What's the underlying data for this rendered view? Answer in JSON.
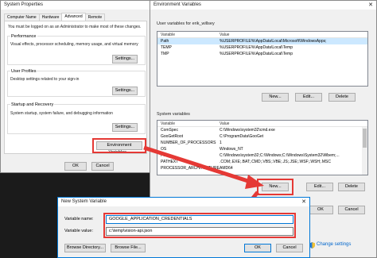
{
  "system_properties": {
    "title": "System Properties",
    "tabs": [
      "Computer Name",
      "Hardware",
      "Advanced",
      "Remote"
    ],
    "admin_note": "You must be logged on as an Administrator to make most of these changes.",
    "performance": {
      "title": "Performance",
      "desc": "Visual effects, processor scheduling, memory usage, and virtual memory",
      "button": "Settings..."
    },
    "user_profiles": {
      "title": "User Profiles",
      "desc": "Desktop settings related to your sign-in",
      "button": "Settings..."
    },
    "startup": {
      "title": "Startup and Recovery",
      "desc": "System startup, system failure, and debugging information",
      "button": "Settings..."
    },
    "env_button": "Environment Variables...",
    "ok": "OK",
    "cancel": "Cancel"
  },
  "env_vars": {
    "title": "Environment Variables",
    "user_section": "User variables for erik_willsey",
    "col_variable": "Variable",
    "col_value": "Value",
    "user_rows": [
      {
        "name": "Path",
        "value": "%USERPROFILE%\\AppData\\Local\\Microsoft\\WindowsApps;"
      },
      {
        "name": "TEMP",
        "value": "%USERPROFILE%\\AppData\\Local\\Temp"
      },
      {
        "name": "TMP",
        "value": "%USERPROFILE%\\AppData\\Local\\Temp"
      }
    ],
    "user_buttons": [
      "New...",
      "Edit...",
      "Delete"
    ],
    "system_section": "System variables",
    "system_rows": [
      {
        "name": "ComSpec",
        "value": "C:\\Windows\\system32\\cmd.exe"
      },
      {
        "name": "GooGetRoot",
        "value": "C:\\ProgramData\\GooGet"
      },
      {
        "name": "NUMBER_OF_PROCESSORS",
        "value": "1"
      },
      {
        "name": "OS",
        "value": "Windows_NT"
      },
      {
        "name": "Path",
        "value": "C:\\Windows\\system32;C:\\Windows;C:\\Windows\\System32\\Wbem;..."
      },
      {
        "name": "PATHEXT",
        "value": ".COM;.EXE;.BAT;.CMD;.VBS;.VBE;.JS;.JSE;.WSF;.WSH;.MSC"
      },
      {
        "name": "PROCESSOR_ARCHITECTURE",
        "value": "AMD64"
      }
    ],
    "system_buttons": [
      "New...",
      "Edit...",
      "Delete"
    ],
    "ok": "OK",
    "cancel": "Cancel"
  },
  "new_var": {
    "title": "New System Variable",
    "name_label": "Variable name:",
    "name_value": "GOOGLE_APPLICATION_CREDENTIALS",
    "value_label": "Variable value:",
    "value_value": "c:\\temp\\vision-api.json",
    "browse_dir": "Browse Directory...",
    "browse_file": "Browse File...",
    "ok": "OK",
    "cancel": "Cancel"
  },
  "change_settings": "Change settings",
  "colors": {
    "highlight": "#e53935",
    "accent": "#0078d7"
  }
}
